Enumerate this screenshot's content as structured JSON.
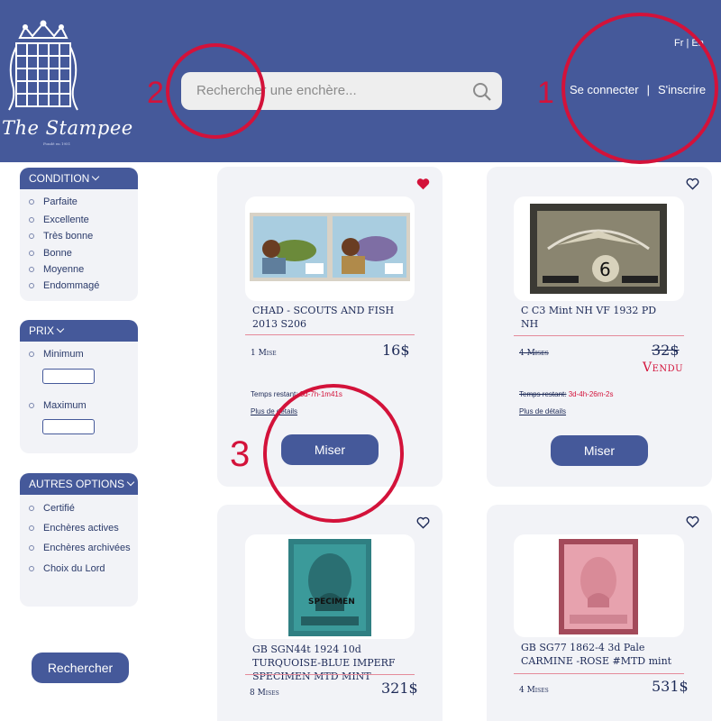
{
  "brand": {
    "name": "The Stampee",
    "tagline": "Fondé en 1951"
  },
  "header": {
    "language": "Fr | En",
    "search_placeholder": "Rechercher une enchère...",
    "login": "Se connecter",
    "separator": "|",
    "signup": "S'inscrire"
  },
  "annotations": {
    "one": "1",
    "two": "2",
    "three": "3"
  },
  "filters": {
    "condition": {
      "title": "CONDITION",
      "options": [
        "Parfaite",
        "Excellente",
        "Très bonne",
        "Bonne",
        "Moyenne",
        "Endommagé"
      ]
    },
    "prix": {
      "title": "PRIX",
      "min_label": "Minimum",
      "max_label": "Maximum"
    },
    "autres": {
      "title": "AUTRES OPTIONS",
      "options": [
        "Certifié",
        "Enchères actives",
        "Enchères archivées",
        "Choix du Lord"
      ]
    },
    "search_button": "Rechercher"
  },
  "listings": [
    {
      "title": "CHAD - SCOUTS AND FISH 2013 S206",
      "bids": "1 Mise",
      "price": "16$",
      "time_label": "Temps restant:",
      "time_value": "3d-7h-1m41s",
      "details": "Plus de détails",
      "button": "Miser",
      "favorited": true
    },
    {
      "title": "C C3 Mint NH VF 1932 PD NH",
      "bids": "4 Mises",
      "price": "32$",
      "status": "Vendu",
      "time_label": "Temps restant:",
      "time_value": "3d-4h-26m-2s",
      "details": "Plus de détails",
      "button": "Miser",
      "favorited": false
    },
    {
      "title": "GB SGN44t 1924 10d TURQUOISE-BLUE IMPERF SPECIMEN MTD MINT",
      "bids": "8 Mises",
      "price": "321$",
      "favorited": false
    },
    {
      "title": "GB SG77 1862-4 3d Pale CARMINE -ROSE #MTD mint",
      "bids": "4 Mises",
      "price": "531$",
      "favorited": false
    }
  ],
  "colors": {
    "primary": "#45599a",
    "accent": "#d3123a",
    "card": "#f2f3f7"
  }
}
